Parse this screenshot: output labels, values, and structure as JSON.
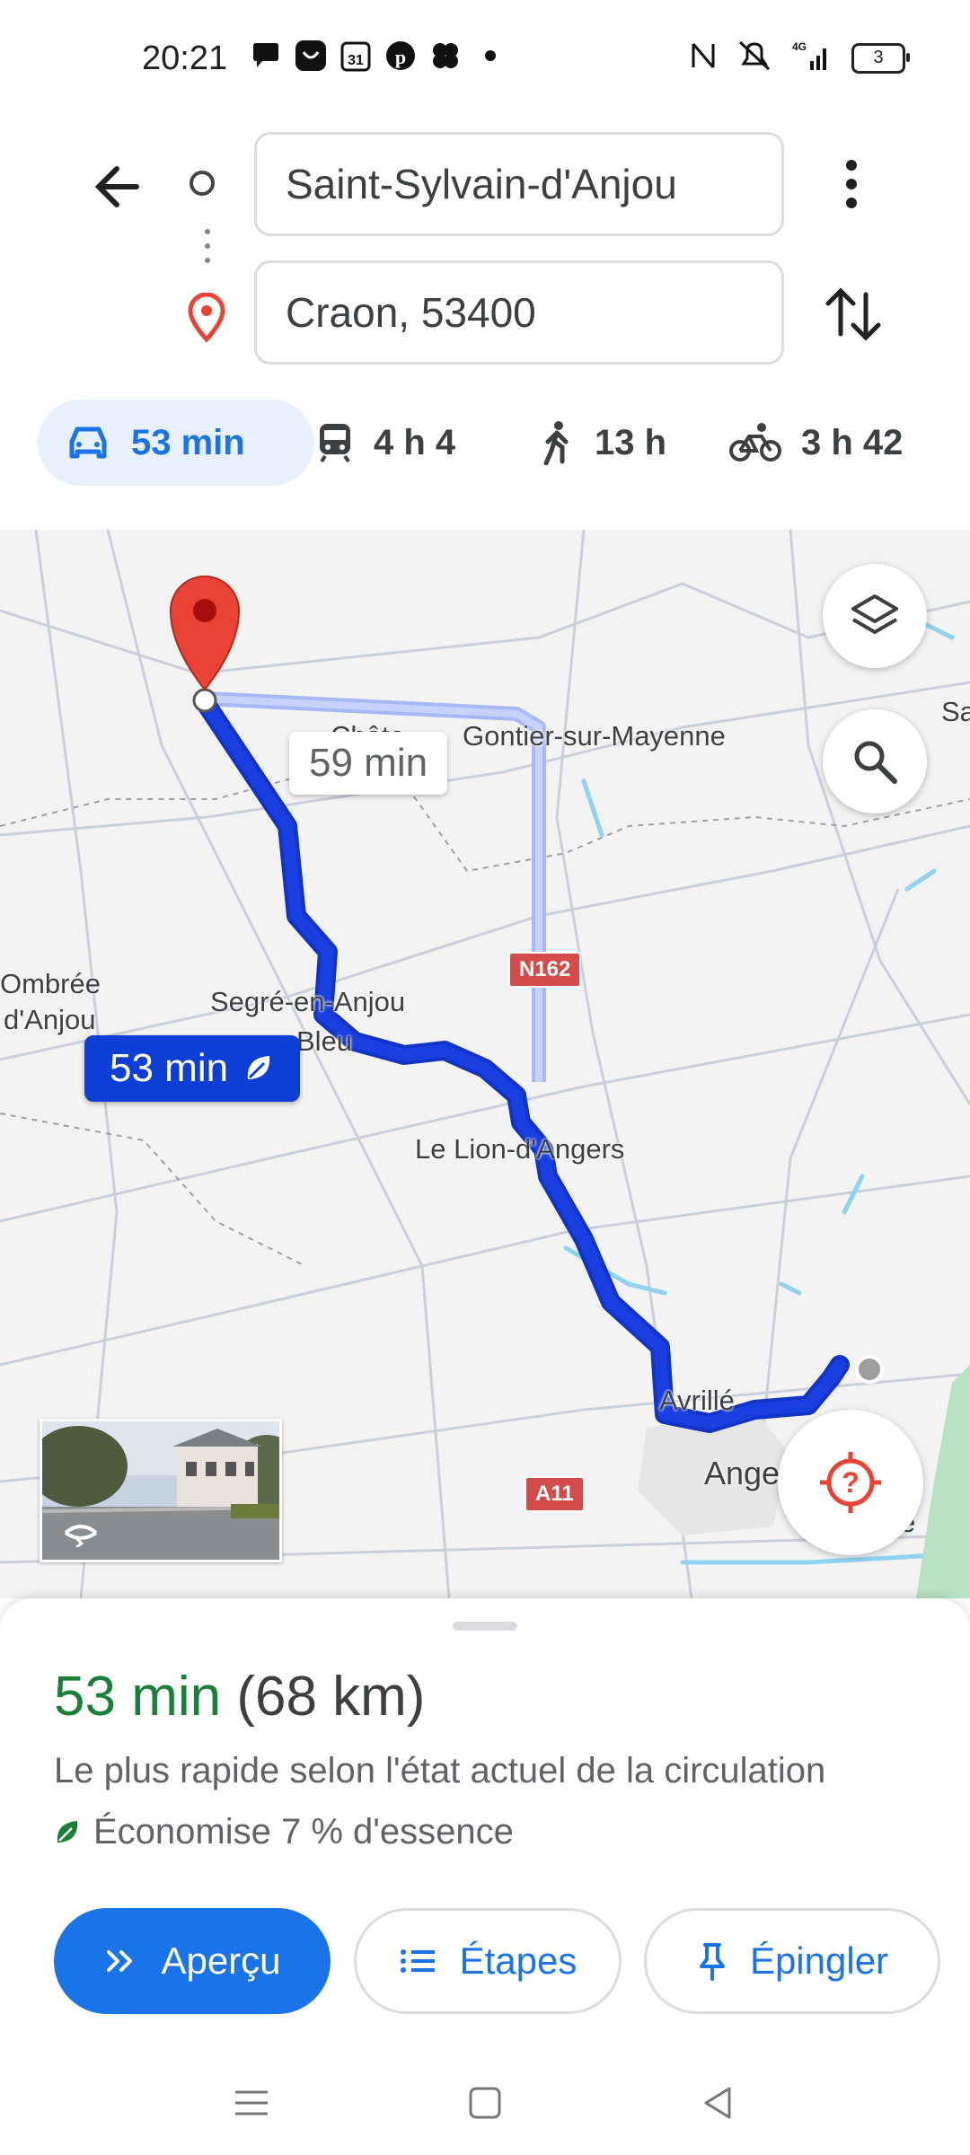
{
  "status_bar": {
    "time": "20:21",
    "notification_icons": [
      "chat-icon",
      "messenger-icon",
      "calendar-icon",
      "pinterest-icon",
      "clover-icon",
      "dot-icon"
    ],
    "calendar_day": "31",
    "system_icons": [
      "nfc-icon",
      "mute-icon",
      "signal-4g-icon",
      "battery-icon"
    ],
    "network": "4G",
    "battery": "3"
  },
  "directions": {
    "origin_value": "Saint-Sylvain-d'Anjou",
    "destination_value": "Craon, 53400"
  },
  "modes": [
    {
      "name": "car",
      "label": "53 min",
      "selected": true
    },
    {
      "name": "transit",
      "label": "4 h 4",
      "selected": false
    },
    {
      "name": "walk",
      "label": "13 h",
      "selected": false
    },
    {
      "name": "bike",
      "label": "3 h 42",
      "selected": false
    }
  ],
  "map": {
    "labels": {
      "chateau_gontier": "Gontier-sur-Mayenne",
      "chateau_partial": "Châte",
      "sa_partial": "Sa",
      "ombree": "Ombrée",
      "d_anjou": "d'Anjou",
      "segre": "Segré-en-Anjou",
      "bleu": "Bleu",
      "lion": "Le Lion-d'Angers",
      "avrille": "Avrillé",
      "angers": "Ange",
      "e_partial": "é"
    },
    "road_badges": {
      "n162": "N162",
      "a11": "A11"
    },
    "alt_route_time": "59 min",
    "main_route_time": "53 min",
    "route_color": "#1a3fe0",
    "alt_route_color": "#a7b8f5"
  },
  "summary": {
    "duration": "53 min",
    "distance": "(68 km)",
    "description": "Le plus rapide selon l'état actuel de la circulation",
    "eco": "Économise 7 % d'essence"
  },
  "actions": {
    "preview": "Aperçu",
    "steps": "Étapes",
    "pin": "Épingler"
  },
  "colors": {
    "accent": "#1a73e8",
    "duration_green": "#188038",
    "destination_red": "#ea4335"
  }
}
